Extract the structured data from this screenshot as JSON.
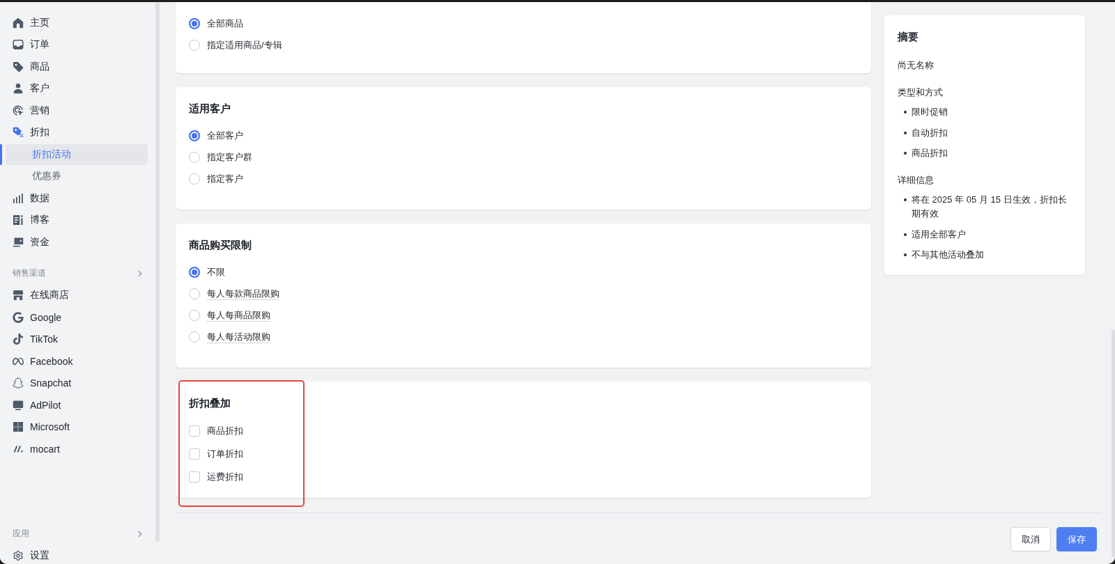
{
  "sidebar": {
    "nav": [
      {
        "label": "主页",
        "selected": false
      },
      {
        "label": "订单",
        "selected": false
      },
      {
        "label": "商品",
        "selected": false
      },
      {
        "label": "客户",
        "selected": false
      },
      {
        "label": "营销",
        "selected": false
      },
      {
        "label": "折扣",
        "selected": false,
        "children": [
          {
            "label": "折扣活动",
            "selected": true
          },
          {
            "label": "优惠券",
            "selected": false
          }
        ]
      },
      {
        "label": "数据",
        "selected": false
      },
      {
        "label": "博客",
        "selected": false
      },
      {
        "label": "资金",
        "selected": false
      }
    ],
    "sections": [
      {
        "title": "销售渠道",
        "items": [
          {
            "label": "在线商店",
            "selected": false
          },
          {
            "label": "Google",
            "selected": false
          },
          {
            "label": "TikTok",
            "selected": false
          },
          {
            "label": "Facebook",
            "selected": false
          },
          {
            "label": "Snapchat",
            "selected": false
          },
          {
            "label": "AdPilot",
            "selected": false
          },
          {
            "label": "Microsoft",
            "selected": false
          },
          {
            "label": "mocart",
            "selected": false
          }
        ]
      },
      {
        "title": "应用"
      }
    ],
    "footer_items": [
      {
        "label": "设置",
        "selected": false
      }
    ]
  },
  "cards": [
    {
      "kind": "radio",
      "options": [
        {
          "label": "全部商品",
          "selected": true
        },
        {
          "label": "指定适用商品/专辑",
          "selected": false
        }
      ]
    },
    {
      "kind": "radio",
      "title": "适用客户",
      "options": [
        {
          "label": "全部客户",
          "selected": true
        },
        {
          "label": "指定客户群",
          "selected": false
        },
        {
          "label": "指定客户",
          "selected": false
        }
      ]
    },
    {
      "kind": "radio",
      "title": "商品购买限制",
      "options": [
        {
          "label": "不限",
          "selected": true,
          "tooltip": false
        },
        {
          "label": "每人每款商品限购",
          "selected": false,
          "tooltip": true
        },
        {
          "label": "每人每商品限购",
          "selected": false,
          "tooltip": true
        },
        {
          "label": "每人每活动限购",
          "selected": false,
          "tooltip": true
        }
      ]
    },
    {
      "kind": "checkbox",
      "title": "折扣叠加",
      "highlighted": true,
      "options": [
        {
          "label": "商品折扣",
          "checked": false
        },
        {
          "label": "订单折扣",
          "checked": false
        },
        {
          "label": "运费折扣",
          "checked": false
        }
      ]
    }
  ],
  "summary": {
    "title": "摘要",
    "name": "尚无名称",
    "groups": [
      {
        "title": "类型和方式",
        "items": [
          "限时促销",
          "自动折扣",
          "商品折扣"
        ]
      },
      {
        "title": "详细信息",
        "items": [
          "将在 2025 年 05 月 15 日生效，折扣长期有效",
          "适用全部客户",
          "不与其他活动叠加"
        ]
      }
    ]
  },
  "footer": {
    "buttons": [
      {
        "label": "取消",
        "kind": "secondary"
      },
      {
        "label": "保存",
        "kind": "primary"
      }
    ]
  }
}
